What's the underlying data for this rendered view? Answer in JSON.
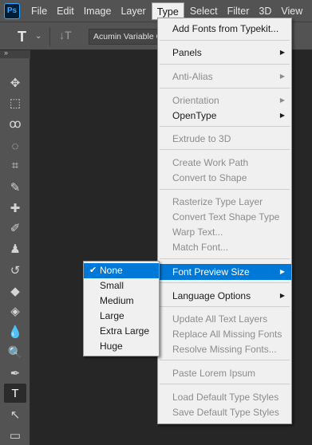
{
  "app": {
    "logo_text": "Ps"
  },
  "menubar": {
    "items": [
      "File",
      "Edit",
      "Image",
      "Layer",
      "Type",
      "Select",
      "Filter",
      "3D",
      "View"
    ],
    "active": "Type"
  },
  "options": {
    "type_icon": "T",
    "chevron": "⌄",
    "orientation_icon": "↓T",
    "font_family": "Acumin Variable C"
  },
  "toolbar": {
    "collapse_icon": "»",
    "tools": [
      {
        "name": "move-tool-icon",
        "glyph": "✥"
      },
      {
        "name": "marquee-tool-icon",
        "glyph": "⬚"
      },
      {
        "name": "lasso-tool-icon",
        "glyph": "ꝏ"
      },
      {
        "name": "quick-selection-tool-icon",
        "glyph": "◌"
      },
      {
        "name": "crop-tool-icon",
        "glyph": "⌗"
      },
      {
        "name": "eyedropper-tool-icon",
        "glyph": "✎"
      },
      {
        "name": "healing-brush-tool-icon",
        "glyph": "✚"
      },
      {
        "name": "brush-tool-icon",
        "glyph": "✐"
      },
      {
        "name": "clone-stamp-tool-icon",
        "glyph": "♟"
      },
      {
        "name": "history-brush-tool-icon",
        "glyph": "↺"
      },
      {
        "name": "eraser-tool-icon",
        "glyph": "◆"
      },
      {
        "name": "paint-bucket-tool-icon",
        "glyph": "◈"
      },
      {
        "name": "blur-tool-icon",
        "glyph": "💧"
      },
      {
        "name": "dodge-tool-icon",
        "glyph": "🔍"
      },
      {
        "name": "pen-tool-icon",
        "glyph": "✒"
      },
      {
        "name": "type-tool-icon",
        "glyph": "T"
      },
      {
        "name": "path-selection-tool-icon",
        "glyph": "↖"
      },
      {
        "name": "shape-tool-icon",
        "glyph": "▭"
      }
    ],
    "active_tool": "type-tool-icon"
  },
  "type_menu": {
    "arrow_glyph": "▶",
    "items": {
      "add_fonts": {
        "label": "Add Fonts from Typekit...",
        "enabled": true
      },
      "panels": {
        "label": "Panels",
        "enabled": true,
        "submenu": true
      },
      "anti_alias": {
        "label": "Anti-Alias",
        "enabled": false,
        "submenu": true
      },
      "orientation": {
        "label": "Orientation",
        "enabled": false,
        "submenu": true
      },
      "opentype": {
        "label": "OpenType",
        "enabled": true,
        "submenu": true
      },
      "extrude_3d": {
        "label": "Extrude to 3D",
        "enabled": false
      },
      "create_work_path": {
        "label": "Create Work Path",
        "enabled": false
      },
      "convert_to_shape": {
        "label": "Convert to Shape",
        "enabled": false
      },
      "rasterize": {
        "label": "Rasterize Type Layer",
        "enabled": false
      },
      "convert_text_shape": {
        "label": "Convert Text Shape Type",
        "enabled": false
      },
      "warp_text": {
        "label": "Warp Text...",
        "enabled": false
      },
      "match_font": {
        "label": "Match Font...",
        "enabled": false
      },
      "font_preview_size": {
        "label": "Font Preview Size",
        "enabled": true,
        "submenu": true,
        "highlighted": true
      },
      "language_options": {
        "label": "Language Options",
        "enabled": true,
        "submenu": true
      },
      "update_all": {
        "label": "Update All Text Layers",
        "enabled": false
      },
      "replace_missing": {
        "label": "Replace All Missing Fonts",
        "enabled": false
      },
      "resolve_missing": {
        "label": "Resolve Missing Fonts...",
        "enabled": false
      },
      "paste_lorem": {
        "label": "Paste Lorem Ipsum",
        "enabled": false
      },
      "load_default": {
        "label": "Load Default Type Styles",
        "enabled": false
      },
      "save_default": {
        "label": "Save Default Type Styles",
        "enabled": false
      }
    }
  },
  "font_preview_submenu": {
    "check_glyph": "✔",
    "selected": "None",
    "options": [
      "None",
      "Small",
      "Medium",
      "Large",
      "Extra Large",
      "Huge"
    ]
  },
  "colors": {
    "highlight": "#0078d7",
    "menu_bg": "#f0f0f0",
    "chrome_bg": "#535353",
    "canvas_bg": "#262626"
  }
}
